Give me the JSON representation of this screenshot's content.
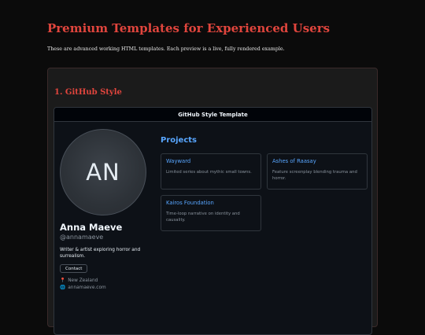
{
  "page": {
    "title": "Premium Templates for Experienced Users",
    "subtitle": "These are advanced working HTML templates. Each preview is a live, fully rendered example."
  },
  "section": {
    "title": "1. GitHub Style"
  },
  "preview": {
    "header": "GitHub Style Template",
    "profile": {
      "avatar_initials": "AN",
      "name": "Anna Maeve",
      "handle": "@annamaeve",
      "bio": "Writer & artist exploring horror and surrealism.",
      "contact_label": "Contact",
      "location_icon": "📍",
      "location": "New Zealand",
      "website_icon": "🌐",
      "website": "annamaeve.com"
    },
    "projects": {
      "title": "Projects",
      "items": [
        {
          "name": "Wayward",
          "description": "Limited series about mythic small towns."
        },
        {
          "name": "Ashes of Raasay",
          "description": "Feature screenplay blending trauma and horror."
        },
        {
          "name": "Kairos Foundation",
          "description": "Time-loop narrative on identity and causality."
        }
      ]
    }
  },
  "colors": {
    "accent_red": "#e0453d",
    "link_blue": "#58a6ff",
    "preview_bg": "#0d1117"
  }
}
